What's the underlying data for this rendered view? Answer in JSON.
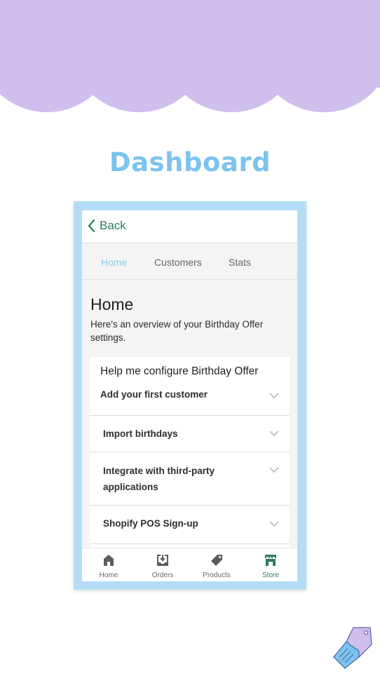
{
  "header": {
    "title": "Dashboard"
  },
  "colors": {
    "scallop": "#cfbfed",
    "title": "#7cc3ef",
    "frame": "#b3ddf7",
    "accent_green": "#2a7a5e",
    "active_tab": "#8ccbe8"
  },
  "app": {
    "back_label": "Back",
    "tabs": [
      {
        "label": "Home",
        "active": true
      },
      {
        "label": "Customers",
        "active": false
      },
      {
        "label": "Stats",
        "active": false
      }
    ],
    "page_title": "Home",
    "page_description": "Here's an overview of your Birthday Offer settings.",
    "card": {
      "title": "Help me configure Birthday Offer",
      "subtitle": "Add your first customer",
      "items": [
        {
          "label": "Import birthdays"
        },
        {
          "label": "Integrate with third-party applications"
        },
        {
          "label": "Shopify POS Sign-up"
        }
      ]
    },
    "tabbar": [
      {
        "label": "Home",
        "icon": "home-icon",
        "active": false
      },
      {
        "label": "Orders",
        "icon": "orders-icon",
        "active": false
      },
      {
        "label": "Products",
        "icon": "tag-icon",
        "active": false
      },
      {
        "label": "Store",
        "icon": "store-icon",
        "active": true
      }
    ]
  }
}
